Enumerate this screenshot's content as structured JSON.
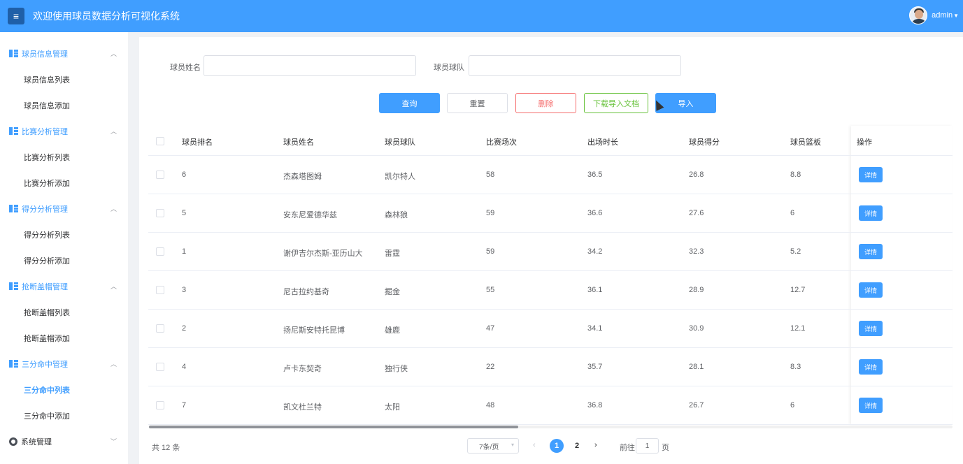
{
  "header": {
    "title": "欢迎使用球员数据分析可视化系统",
    "menu_icon": "menu-icon",
    "username": "admin"
  },
  "sidebar": {
    "groups": [
      {
        "label": "球员信息管理",
        "items": [
          "球员信息列表",
          "球员信息添加"
        ]
      },
      {
        "label": "比赛分析管理",
        "items": [
          "比赛分析列表",
          "比赛分析添加"
        ]
      },
      {
        "label": "得分分析管理",
        "items": [
          "得分分析列表",
          "得分分析添加"
        ]
      },
      {
        "label": "抢断盖帽管理",
        "items": [
          "抢断盖帽列表",
          "抢断盖帽添加"
        ]
      },
      {
        "label": "三分命中管理",
        "items": [
          "三分命中列表",
          "三分命中添加"
        ]
      }
    ],
    "active_item": "三分命中列表",
    "system": "系统管理"
  },
  "search": {
    "name_label": "球员姓名",
    "name_value": "",
    "team_label": "球员球队",
    "team_value": ""
  },
  "buttons": {
    "query": "查询",
    "reset": "重置",
    "delete": "删除",
    "download": "下载导入文档",
    "import": "导入"
  },
  "table": {
    "columns": [
      "球员排名",
      "球员姓名",
      "球员球队",
      "比赛场次",
      "出场时长",
      "球员得分",
      "球员篮板",
      "操作"
    ],
    "rows": [
      [
        "6",
        "杰森塔图姆",
        "凯尔特人",
        "58",
        "36.5",
        "26.8",
        "8.8"
      ],
      [
        "5",
        "安东尼爱德华兹",
        "森林狼",
        "59",
        "36.6",
        "27.6",
        "6"
      ],
      [
        "1",
        "谢伊吉尔杰斯-亚历山大",
        "雷霆",
        "59",
        "34.2",
        "32.3",
        "5.2"
      ],
      [
        "3",
        "尼古拉约基奇",
        "掘金",
        "55",
        "36.1",
        "28.9",
        "12.7"
      ],
      [
        "2",
        "扬尼斯安特托昆博",
        "雄鹿",
        "47",
        "34.1",
        "30.9",
        "12.1"
      ],
      [
        "4",
        "卢卡东契奇",
        "独行侠",
        "22",
        "35.7",
        "28.1",
        "8.3"
      ],
      [
        "7",
        "凯文杜兰特",
        "太阳",
        "48",
        "36.8",
        "26.7",
        "6"
      ]
    ],
    "detail_label": "详情"
  },
  "pagination": {
    "total": "共 12 条",
    "page_size": "7条/页",
    "pages": [
      "1",
      "2"
    ],
    "current": "1",
    "goto_label": "前往",
    "goto_value": "1",
    "goto_suffix": "页"
  }
}
